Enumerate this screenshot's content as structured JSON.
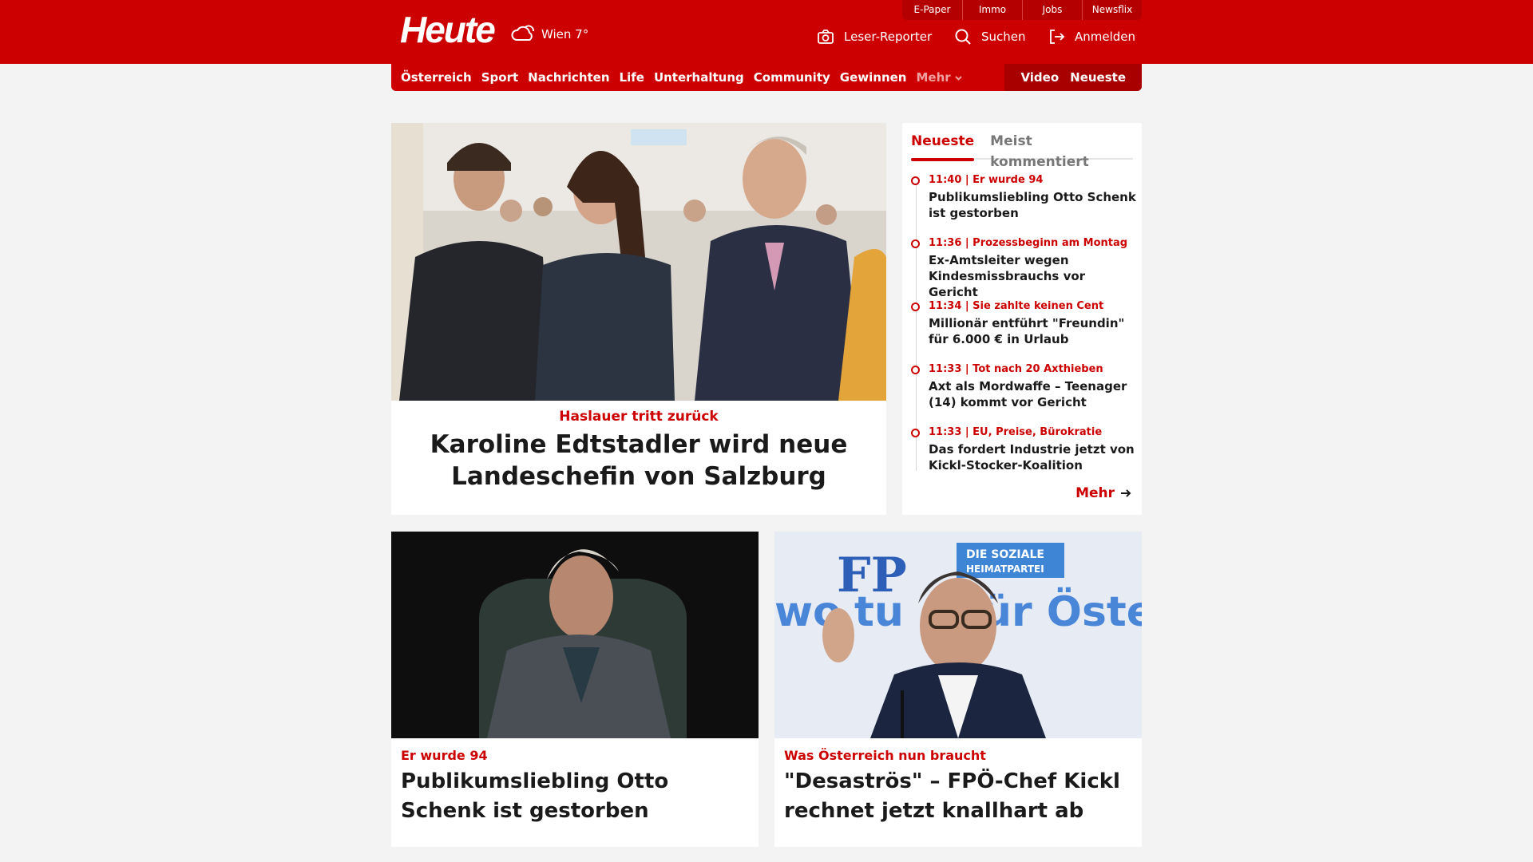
{
  "header": {
    "logo": "Heute",
    "weather": "Wien 7°",
    "service_tabs": [
      "E-Paper",
      "Immo",
      "Jobs",
      "Newsflix"
    ],
    "actions": {
      "reporter": "Leser-Reporter",
      "search": "Suchen",
      "login": "Anmelden"
    }
  },
  "nav": {
    "items": [
      "Österreich",
      "Sport",
      "Nachrichten",
      "Life",
      "Unterhaltung",
      "Community",
      "Gewinnen"
    ],
    "more": "Mehr",
    "right": [
      "Video",
      "Neueste"
    ]
  },
  "hero": {
    "kicker": "Haslauer tritt zurück",
    "title": "Karoline Edtstadler wird neue Landeschefin von Salzburg"
  },
  "ticker": {
    "tabs": [
      "Neueste",
      "Meist kommentiert"
    ],
    "items": [
      {
        "meta": "11:40 | Er wurde 94",
        "title": "Publikumsliebling Otto Schenk ist gestorben"
      },
      {
        "meta": "11:36 | Prozessbeginn am Montag",
        "title": "Ex-Amtsleiter wegen Kindesmissbrauchs vor Gericht"
      },
      {
        "meta": "11:34 | Sie zahlte keinen Cent",
        "title": "Millionär entführt \"Freundin\" für 6.000 € in Urlaub"
      },
      {
        "meta": "11:33 | Tot nach 20 Axthieben",
        "title": "Axt als Mordwaffe – Teenager (14) kommt vor Gericht"
      },
      {
        "meta": "11:33 | EU, Preise, Bürokratie",
        "title": "Das fordert Industrie jetzt von Kickl-Stocker-Koalition"
      }
    ],
    "more": "Mehr"
  },
  "cards": [
    {
      "kicker": "Er wurde 94",
      "title": "Publikumsliebling Otto Schenk ist gestorben"
    },
    {
      "kicker": "Was Österreich nun braucht",
      "title": "\"Desaströs\" – FPÖ-Chef Kickl rechnet jetzt knallhart ab",
      "image_text": [
        "FP",
        "DIE SOZIALE",
        "HEIMATPARTEI",
        "wo",
        "tu",
        "ür Öste"
      ]
    }
  ],
  "colors": {
    "brand_red": "#cc0000",
    "dark_red": "#a80000",
    "page_bg": "#f3f3f3"
  }
}
